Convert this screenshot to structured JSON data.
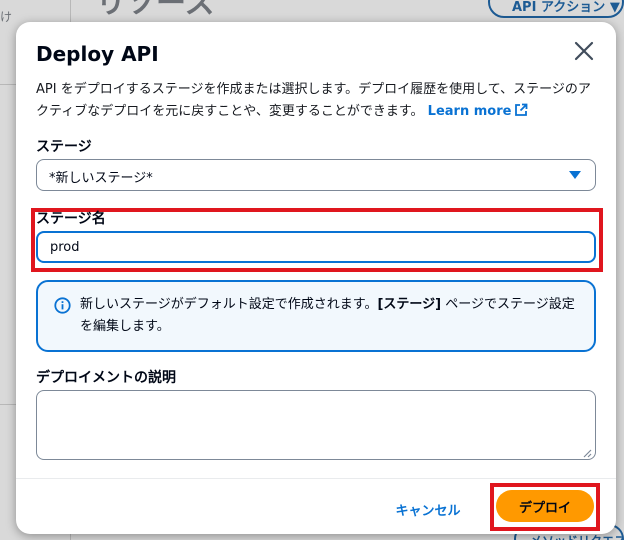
{
  "background": {
    "heading": "リソース",
    "left_text": "け",
    "api_action_label": "API アクション ▼",
    "bottom_button_label": "メソッドリクエスト"
  },
  "modal": {
    "title": "Deploy API",
    "description": "API をデプロイするステージを作成または選択します。デプロイ履歴を使用して、ステージのアクティブなデプロイを元に戻すことや、変更することができます。",
    "learn_more": "Learn more"
  },
  "stage": {
    "label": "ステージ",
    "selected": "*新しいステージ*"
  },
  "stage_name": {
    "label": "ステージ名",
    "value": "prod"
  },
  "info": {
    "text_before": "新しいステージがデフォルト設定で作成されます。",
    "bold": "[ステージ]",
    "text_after": " ページでステージ設定を編集します。"
  },
  "description_field": {
    "label": "デプロイメントの説明",
    "value": ""
  },
  "footer": {
    "cancel_label": "キャンセル",
    "deploy_label": "デプロイ"
  },
  "colors": {
    "primary_blue": "#0972d3",
    "deploy_orange": "#ff9900",
    "highlight_red": "#e0161e"
  }
}
